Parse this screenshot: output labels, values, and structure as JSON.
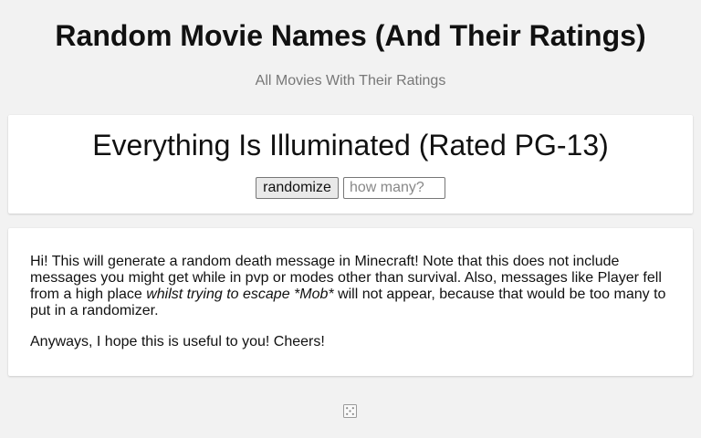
{
  "header": {
    "title": "Random Movie Names (And Their Ratings)",
    "subtitle": "All Movies With Their Ratings"
  },
  "generator": {
    "result": "Everything Is Illuminated (Rated PG-13)",
    "randomize_label": "randomize",
    "count_placeholder": "how many?",
    "count_value": ""
  },
  "info": {
    "para1_before": "Hi! This will generate a random death message in Minecraft! Note that this does not include messages you might get while in pvp or modes other than survival. Also, messages like Player fell from a high place ",
    "para1_italic": "whilst trying to escape *Mob*",
    "para1_after": " will not appear, because that would be too many to put in a randomizer.",
    "para2": "Anyways, I hope this is useful to you! Cheers!"
  },
  "footer": {
    "icon": "dice-icon"
  }
}
